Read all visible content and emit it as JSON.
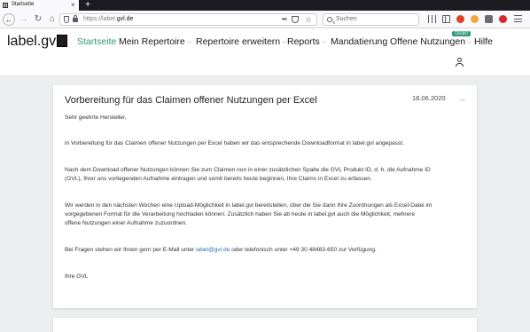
{
  "browser": {
    "tab_title": "Startseite",
    "favicon_letter": "g",
    "url_prefix": "https://label.",
    "url_domain": "gvl.de",
    "search_placeholder": "Suchen"
  },
  "site": {
    "logo_text": "label.gv",
    "nav": {
      "startseite": "Startseite",
      "mein_repertoire": "Mein Repertoire",
      "repertoire_erweitern": "Repertoire erweitern",
      "reports": "Reports",
      "mandatierung": "Mandatierung",
      "offene_nutzungen": "Offene Nutzungen",
      "offene_nutzungen_badge": "720387",
      "hilfe": "Hilfe"
    },
    "accent_color": "#2c9a7a"
  },
  "article": {
    "title": "Vorbereitung für das Claimen offener Nutzungen per Excel",
    "date": "18.06.2020",
    "greeting": "Sehr geehrte Hersteller,",
    "p1": "in Vorbereitung für das Claimen offener Nutzungen per Excel haben wir das entsprechende Downloadformat in label.gvl angepasst.",
    "p2_line1": "Nach dem Download offener Nutzungen können Sie zum Claimen nun in einer zusätzlichen Spalte die GVL Produkt ID, d. h. die Aufnahme ID",
    "p2_line2": "(GVL), Ihrer uns vorliegenden Aufnahme eintragen und somit bereits heute beginnen, Ihre Claims in Excel zu erfassen.",
    "p3_line1": "Wir werden in den nächsten Wochen eine Upload-Möglichkeit in label.gvl bereitstellen, über die Sie dann Ihre Zuordnungen als Excel-Datei im",
    "p3_line2": "vorgegebenen Format für die Verarbeitung hochladen können. Zusätzlich haben Sie ab heute in label.gvl auch die Möglichkeit, mehrere",
    "p3_line3": "offene Nutzungen einer Aufnahme zuzuordnen.",
    "p4_before": "Bei Fragen stehen wir Ihnen gern per E-Mail unter ",
    "p4_email": "label@gvl.de",
    "p4_after": " oder telefonisch unter +49 30 48483-650 zur Verfügung.",
    "closing": "Ihre GVL"
  },
  "icons": {
    "back": "arrow-left",
    "forward": "arrow-right",
    "reload": "reload",
    "home": "home",
    "menu": "hamburger",
    "user": "user",
    "collapse": "chevron-up"
  }
}
